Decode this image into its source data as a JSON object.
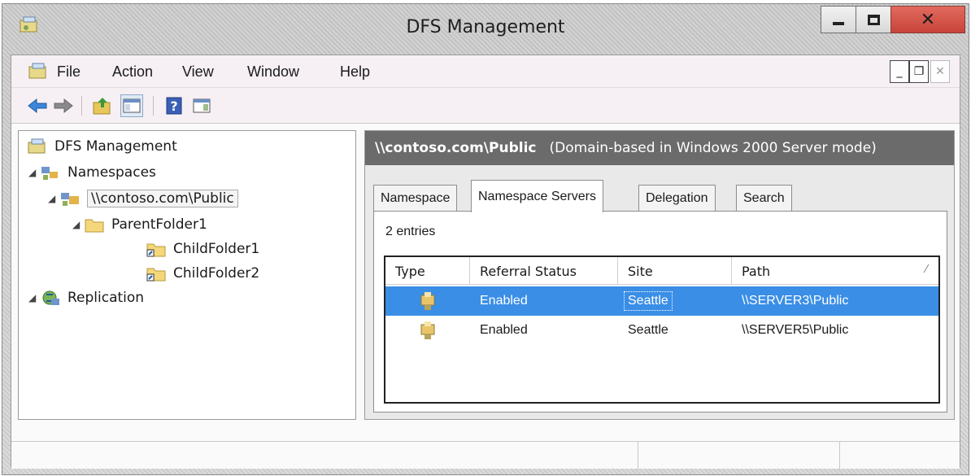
{
  "window": {
    "title": "DFS Management"
  },
  "menu": {
    "items": [
      "File",
      "Action",
      "View",
      "Window",
      "Help"
    ]
  },
  "toolbar": {
    "icons": [
      "back-arrow-icon",
      "forward-arrow-icon",
      "up-folder-icon",
      "show-hide-console-tree-icon",
      "help-icon",
      "show-action-pane-icon"
    ]
  },
  "tree": {
    "root": "DFS Management",
    "namespaces": "Namespaces",
    "namespace": "\\\\contoso.com\\Public",
    "parent_folder": "ParentFolder1",
    "child1": "ChildFolder1",
    "child2": "ChildFolder2",
    "replication": "Replication"
  },
  "details": {
    "header_path": "\\\\contoso.com\\Public",
    "header_mode": "(Domain-based in Windows 2000 Server mode)",
    "tabs": [
      "Namespace",
      "Namespace Servers",
      "Delegation",
      "Search"
    ],
    "active_tab": "Namespace Servers",
    "entries": "2 entries",
    "columns": [
      "Type",
      "Referral Status",
      "Site",
      "Path"
    ],
    "rows": [
      {
        "referral": "Enabled",
        "site": "Seattle",
        "path": "\\\\SERVER3\\Public",
        "selected": true
      },
      {
        "referral": "Enabled",
        "site": "Seattle",
        "path": "\\\\SERVER5\\Public",
        "selected": false
      }
    ]
  },
  "colors": {
    "selection": "#3a8ee6",
    "header_bg": "#6b6b6b",
    "close_button": "#c8443a"
  }
}
